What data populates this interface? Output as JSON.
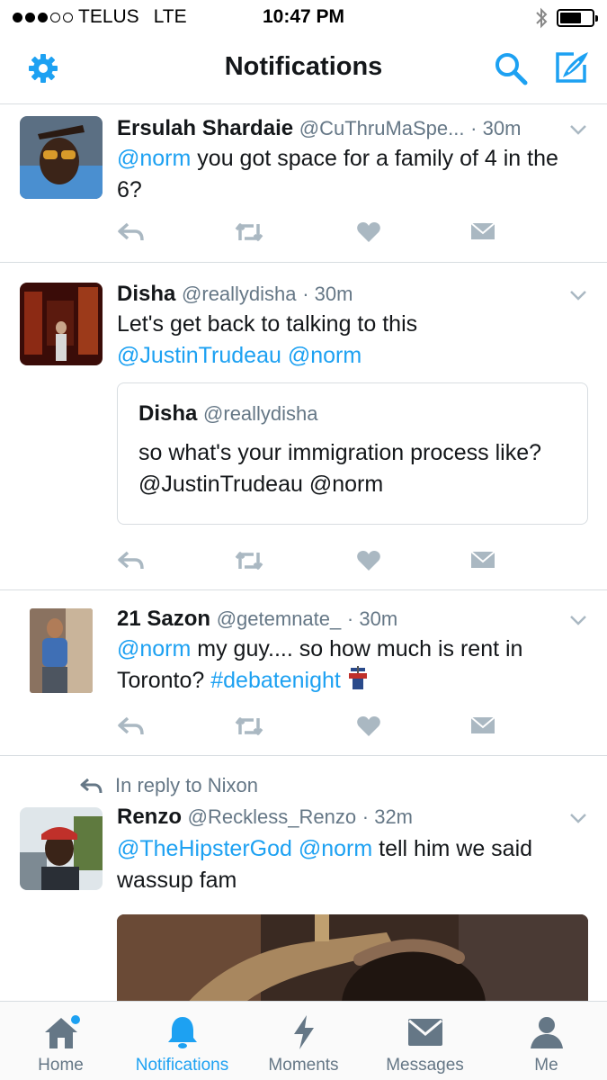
{
  "status_bar": {
    "carrier": "TELUS",
    "network": "LTE",
    "time": "10:47 PM"
  },
  "nav": {
    "title": "Notifications",
    "settings_icon": "gear-icon",
    "search_icon": "search-icon",
    "compose_icon": "compose-icon"
  },
  "tweets": [
    {
      "name": "Ersulah Shardaie",
      "handle": "@CuThruMaSpe...",
      "time": "· 30m",
      "text_parts": [
        "@norm",
        " you got space for a family of 4 in the 6?"
      ]
    },
    {
      "name": "Disha",
      "handle": "@reallydisha",
      "time": "· 30m",
      "text_line1": "Let's get back to talking to this",
      "mention1": "@JustinTrudeau",
      "mention2": "@norm",
      "quote": {
        "name": "Disha",
        "handle": "@reallydisha",
        "text": "so what's your immigration process like? @JustinTrudeau @norm"
      }
    },
    {
      "name": "21 Sazon",
      "handle": "@getemnate_",
      "time": "· 30m",
      "mention": "@norm",
      "text_mid": " my guy.... so how much is rent in Toronto? ",
      "hashtag": "#debatenight"
    },
    {
      "reply_context": "In reply to Nixon",
      "name": "Renzo",
      "handle": "@Reckless_Renzo",
      "time": "· 32m",
      "mention1": "@TheHipsterGod",
      "mention2": "@norm",
      "text_rest": " tell him we said wassup fam"
    }
  ],
  "tabs": [
    {
      "label": "Home",
      "icon": "home-icon"
    },
    {
      "label": "Notifications",
      "icon": "bell-icon"
    },
    {
      "label": "Moments",
      "icon": "lightning-icon"
    },
    {
      "label": "Messages",
      "icon": "envelope-icon"
    },
    {
      "label": "Me",
      "icon": "person-icon"
    }
  ],
  "colors": {
    "accent": "#1da1f2",
    "text": "#14171a",
    "secondary": "#657786",
    "action_icons": "#aab8c2",
    "divider": "#d8dde1"
  }
}
